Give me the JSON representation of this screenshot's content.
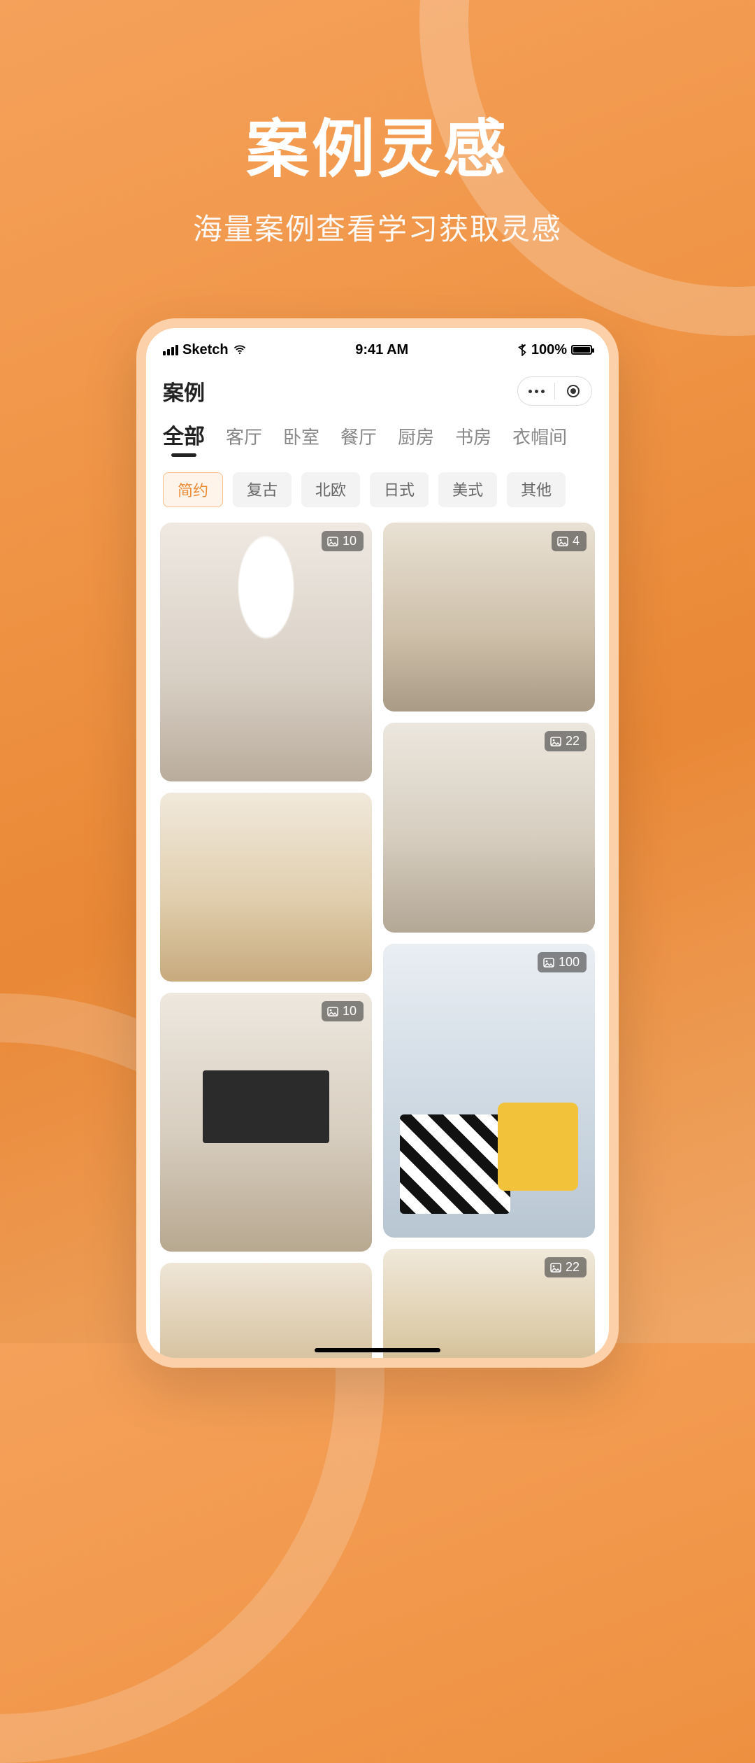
{
  "hero": {
    "title": "案例灵感",
    "subtitle": "海量案例查看学习获取灵感"
  },
  "statusbar": {
    "carrier": "Sketch",
    "time": "9:41 AM",
    "battery_text": "100%"
  },
  "appbar": {
    "title": "案例"
  },
  "tabs": [
    {
      "label": "全部",
      "active": true
    },
    {
      "label": "客厅",
      "active": false
    },
    {
      "label": "卧室",
      "active": false
    },
    {
      "label": "餐厅",
      "active": false
    },
    {
      "label": "厨房",
      "active": false
    },
    {
      "label": "书房",
      "active": false
    },
    {
      "label": "衣帽间",
      "active": false
    }
  ],
  "chips": [
    {
      "label": "简约",
      "active": true
    },
    {
      "label": "复古",
      "active": false
    },
    {
      "label": "北欧",
      "active": false
    },
    {
      "label": "日式",
      "active": false
    },
    {
      "label": "美式",
      "active": false
    },
    {
      "label": "其他",
      "active": false
    }
  ],
  "cards": [
    {
      "count": "10"
    },
    {
      "count": "4"
    },
    {
      "count": ""
    },
    {
      "count": "22"
    },
    {
      "count": "10"
    },
    {
      "count": "100"
    },
    {
      "count": ""
    },
    {
      "count": "22"
    }
  ]
}
